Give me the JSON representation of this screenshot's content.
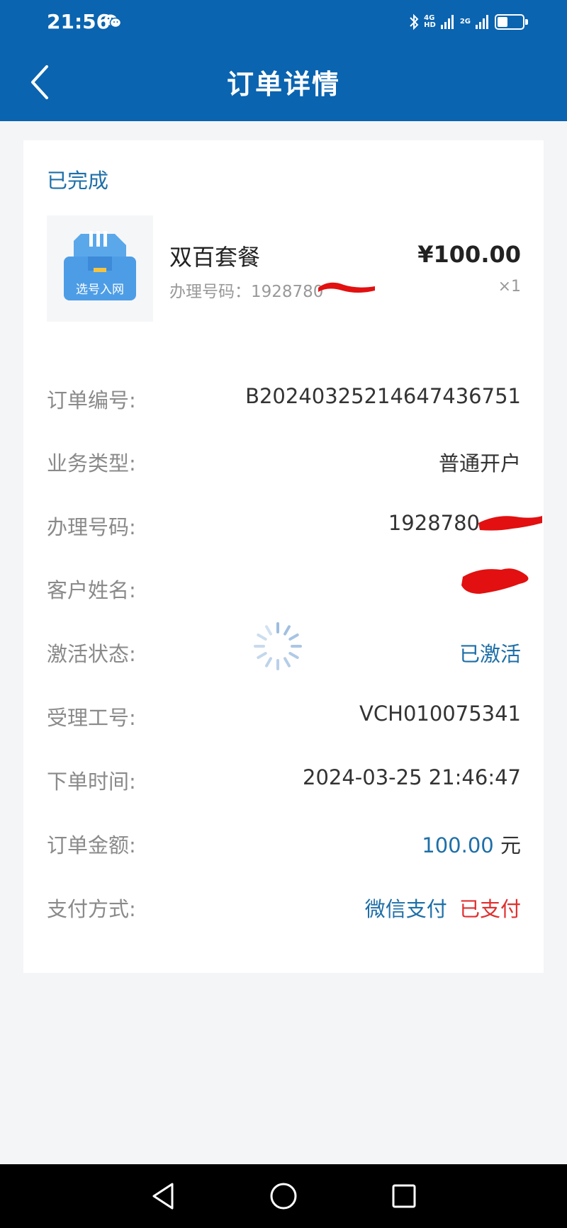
{
  "status_bar": {
    "time": "21:56",
    "network_1": [
      "4G",
      "HD"
    ],
    "network_2": [
      "2G",
      ""
    ]
  },
  "header": {
    "title": "订单详情"
  },
  "order": {
    "status": "已完成",
    "product": {
      "name": "双百套餐",
      "number_label": "办理号码：",
      "number_value": "1928780",
      "price": "¥100.00",
      "quantity": "×1",
      "thumb_text": "选号入网"
    },
    "rows": [
      {
        "label": "订单编号:",
        "value": "B20240325214647436751"
      },
      {
        "label": "业务类型:",
        "value": "普通开户"
      },
      {
        "label": "办理号码:",
        "value": "1928780"
      },
      {
        "label": "客户姓名:",
        "value": ""
      },
      {
        "label": "激活状态:",
        "value": "已激活"
      },
      {
        "label": "受理工号:",
        "value": "VCH010075341"
      },
      {
        "label": "下单时间:",
        "value": "2024-03-25 21:46:47"
      },
      {
        "label": "订单金额:",
        "amount": "100.00",
        "unit": "元"
      },
      {
        "label": "支付方式:",
        "method": "微信支付",
        "pay_status": "已支付"
      }
    ]
  },
  "colors": {
    "header_bg": "#0a64b0",
    "accent_blue": "#1e6fa8",
    "paid_red": "#e03030"
  }
}
